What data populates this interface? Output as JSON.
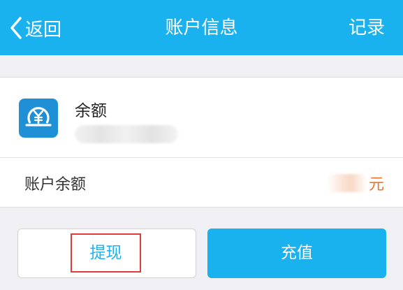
{
  "nav": {
    "back_label": "返回",
    "title": "账户信息",
    "record_label": "记录",
    "bar_color": "#1ab1ef"
  },
  "balance": {
    "title": "余额",
    "icon": "yen-coin-icon"
  },
  "account_row": {
    "label": "账户余额",
    "unit": "元",
    "unit_color": "#f07326"
  },
  "actions": {
    "withdraw_label": "提现",
    "recharge_label": "充值",
    "highlight_color": "#e23b3b"
  }
}
